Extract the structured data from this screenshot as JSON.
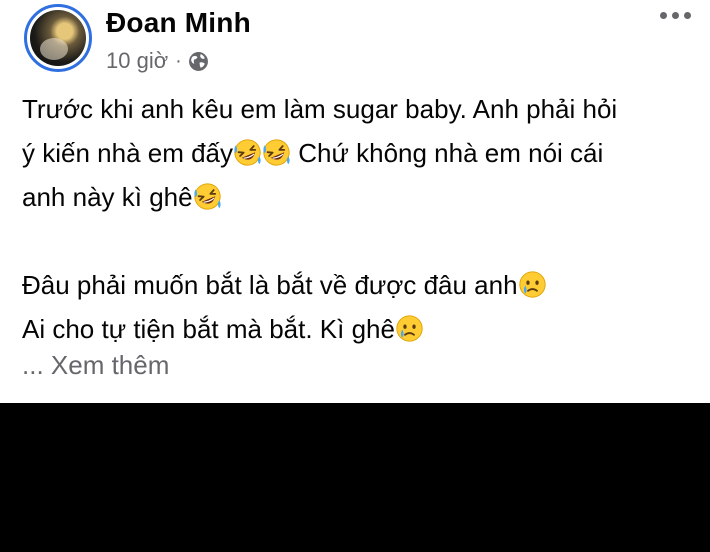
{
  "post": {
    "author": "Đoan Minh",
    "timestamp": "10 giờ",
    "separator": "·",
    "privacy_icon": "globe-icon",
    "menu_icon": "more-options-icon",
    "content": {
      "line1": "Trước khi anh kêu em làm sugar baby. Anh phải hỏi",
      "line2_a": "ý kiến nhà em đấy",
      "line2_b": " Chứ không nhà em nói cái",
      "line3": "anh này kì ghê",
      "line4": "Đâu phải muốn bắt là bắt về được đâu anh",
      "line5": "Ai cho tự tiện bắt mà bắt. Kì ghê"
    },
    "emojis": {
      "laughing": "rolling-on-floor-laughing-emoji",
      "sad": "sad-tear-emoji"
    },
    "see_more": "... Xem thêm"
  },
  "colors": {
    "text": "#050505",
    "secondary": "#65676b",
    "avatar_ring": "#2f6fe0",
    "emoji_yellow": "#ffcc33",
    "tear_blue": "#4aa8f0"
  }
}
